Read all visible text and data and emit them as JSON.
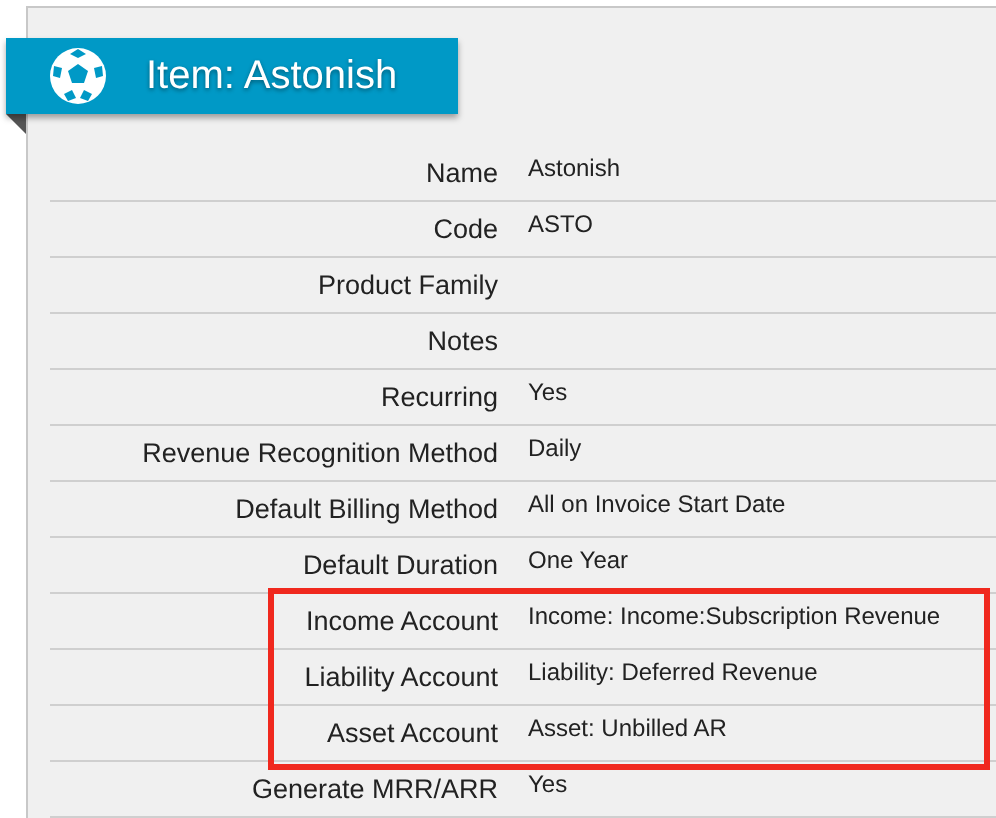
{
  "title": "Item: Astonish",
  "fields": [
    {
      "label": "Name",
      "value": "Astonish",
      "highlighted": false
    },
    {
      "label": "Code",
      "value": "ASTO",
      "highlighted": false
    },
    {
      "label": "Product Family",
      "highlighted": false
    },
    {
      "label": "Notes",
      "highlighted": false
    },
    {
      "label": "Recurring",
      "value": "Yes",
      "highlighted": false
    },
    {
      "label": "Revenue Recognition Method",
      "value": "Daily",
      "highlighted": false
    },
    {
      "label": "Default Billing Method",
      "value": "All on Invoice Start Date",
      "highlighted": false
    },
    {
      "label": "Default Duration",
      "value": "One Year",
      "highlighted": false
    },
    {
      "label": "Income Account",
      "value": "Income: Income:Subscription Revenue",
      "highlighted": true
    },
    {
      "label": "Liability Account",
      "value": "Liability: Deferred Revenue",
      "highlighted": true
    },
    {
      "label": "Asset Account",
      "value": "Asset: Unbilled AR",
      "highlighted": true
    },
    {
      "label": "Generate MRR/ARR",
      "value": "Yes",
      "highlighted": false
    }
  ]
}
